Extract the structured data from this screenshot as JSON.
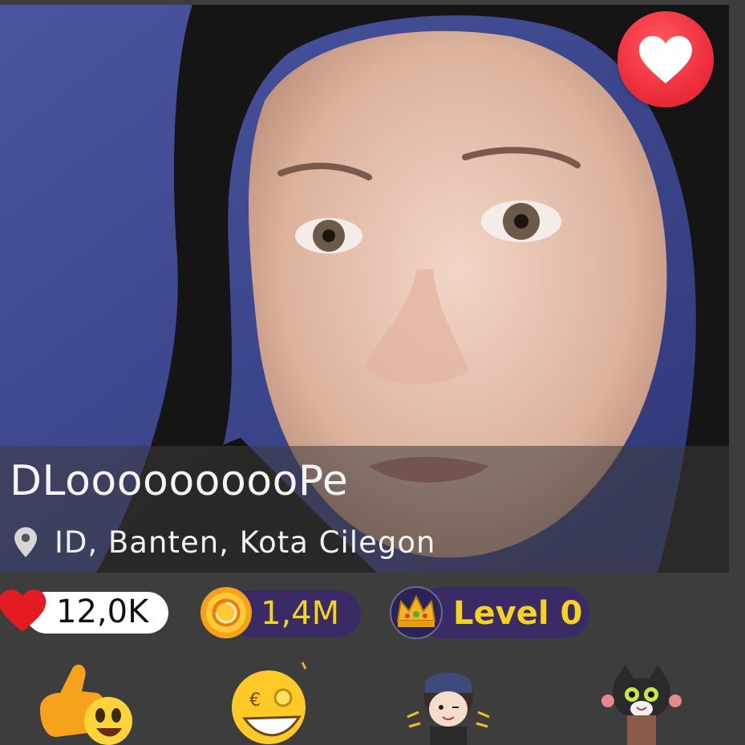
{
  "profile": {
    "username": "DLoooooooooPe",
    "location": "ID, Banten, Kota Cilegon"
  },
  "stats": {
    "likes": "12,0K",
    "coins": "1,4M",
    "level": "Level 0"
  },
  "icons": {
    "favorite": "heart-icon",
    "location": "map-pin-icon",
    "likes": "heart-icon",
    "coins": "coin-icon",
    "level": "crown-icon"
  },
  "stickers": [
    "thumbs-up-emoji-sticker",
    "money-grin-emoji-sticker",
    "girl-thumbs-up-sticker",
    "cat-waving-sticker"
  ],
  "colors": {
    "background": "#3d3d3d",
    "favorite": "#f0323f",
    "pill_dark": "#3a2a66",
    "gold_text": "#f5d320"
  }
}
